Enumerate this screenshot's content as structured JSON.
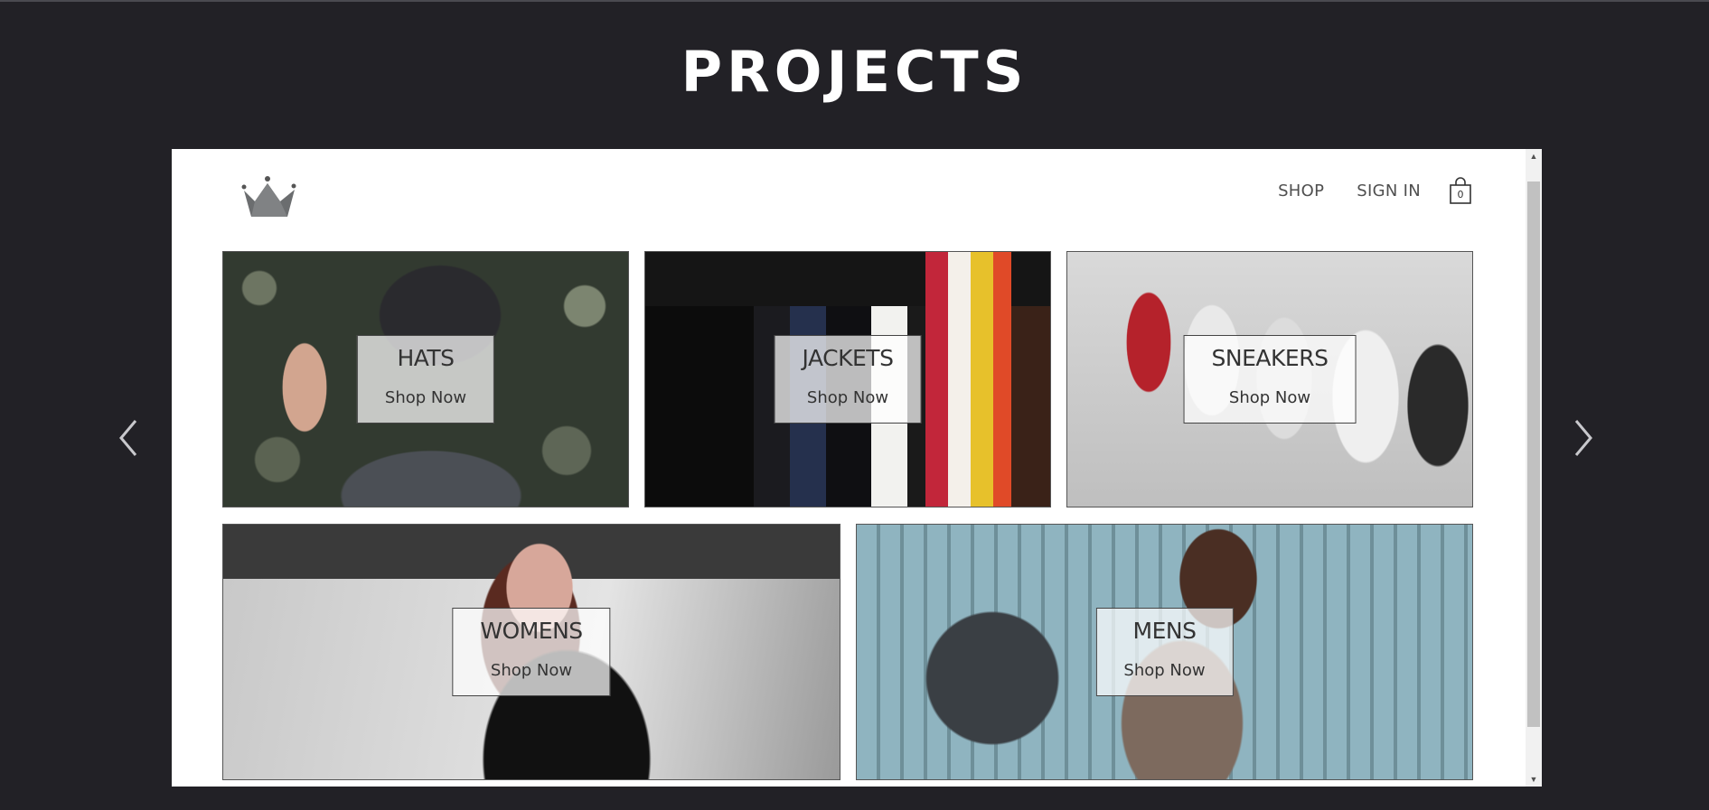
{
  "page": {
    "title": "PROJECTS"
  },
  "carousel": {
    "prev_icon": "chevron-left-icon",
    "next_icon": "chevron-right-icon"
  },
  "preview": {
    "logo_icon": "crown-icon",
    "nav": {
      "shop_label": "SHOP",
      "signin_label": "SIGN IN",
      "cart_icon": "shopping-bag-icon",
      "cart_count": "0"
    },
    "categories": [
      {
        "title": "HATS",
        "subtitle": "Shop Now"
      },
      {
        "title": "JACKETS",
        "subtitle": "Shop Now"
      },
      {
        "title": "SNEAKERS",
        "subtitle": "Shop Now"
      },
      {
        "title": "WOMENS",
        "subtitle": "Shop Now"
      },
      {
        "title": "MENS",
        "subtitle": "Shop Now"
      }
    ]
  },
  "colors": {
    "background": "#222126",
    "title": "#ffffff",
    "nav_text": "#4f4f4f"
  }
}
